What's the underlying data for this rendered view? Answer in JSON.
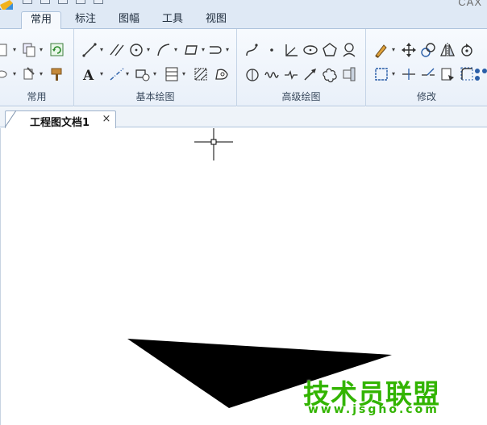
{
  "app": {
    "title": "CAX"
  },
  "menu": {
    "tabs": [
      "常用",
      "标注",
      "图幅",
      "工具",
      "视图"
    ],
    "active": "常用"
  },
  "ribbon": {
    "groups": [
      {
        "label": "常用"
      },
      {
        "label": "基本绘图"
      },
      {
        "label": "高级绘图"
      },
      {
        "label": "修改"
      }
    ]
  },
  "document": {
    "tab_label": "工程图文档1",
    "close_glyph": "×"
  },
  "watermark": {
    "main": "技术员联盟",
    "sub": "www.jsgho.com"
  },
  "colors": {
    "ribbon_bg": "#e9f0f9",
    "border": "#aec3dc",
    "watermark": "#32b400",
    "shape": "#000000"
  }
}
